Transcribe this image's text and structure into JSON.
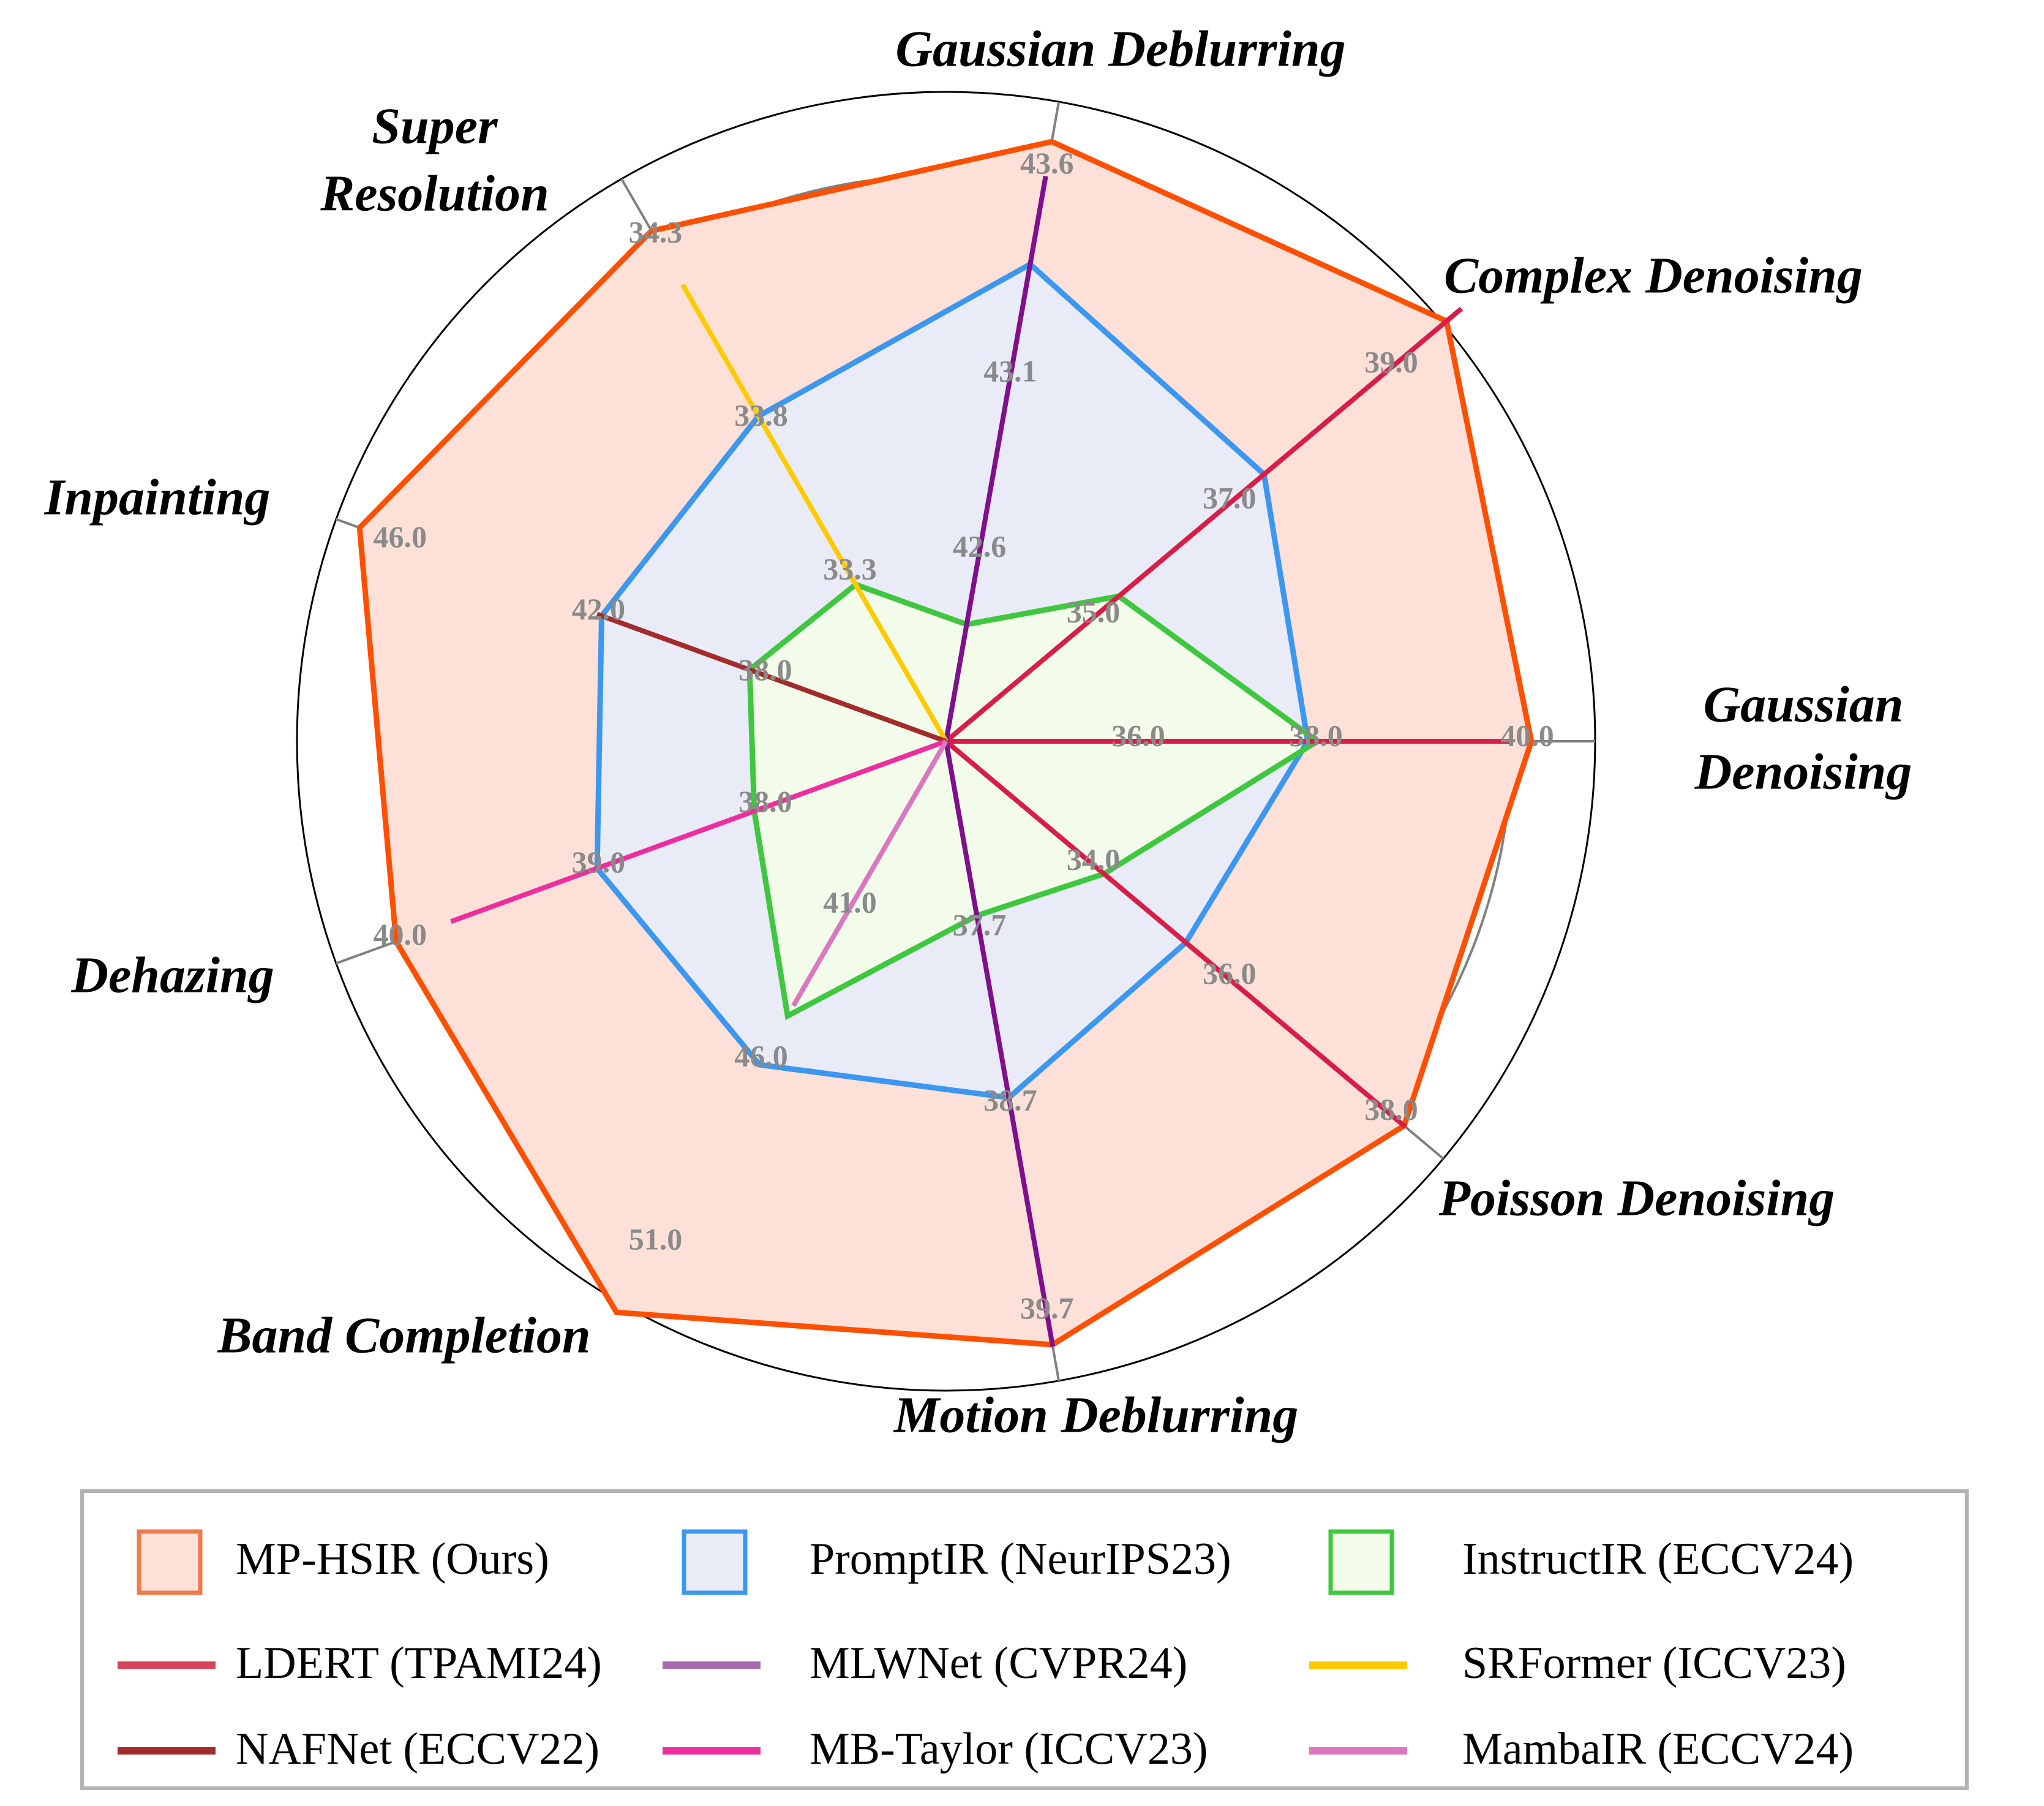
{
  "chart_data": {
    "type": "radar",
    "title": "",
    "axes": [
      {
        "label": "Gaussian Denoising",
        "ticks": [
          "36.0",
          "38.0",
          "40.0"
        ],
        "range": [
          34,
          40.4
        ]
      },
      {
        "label": "Complex Denoising",
        "ticks": [
          "35.0",
          "37.0",
          "39.0"
        ],
        "range": [
          33,
          40.3
        ]
      },
      {
        "label": "Gaussian Deblurring",
        "ticks": [
          "42.6",
          "43.1",
          "43.6"
        ],
        "range": [
          42.1,
          43.8
        ]
      },
      {
        "label": "Super Resolution",
        "ticks": [
          "33.3",
          "33.8",
          "34.3"
        ],
        "range": [
          32.8,
          34.5
        ]
      },
      {
        "label": "Inpainting",
        "ticks": [
          "38.0",
          "42.0",
          "46.0"
        ],
        "range": [
          34,
          47.5
        ]
      },
      {
        "label": "Dehazing",
        "ticks": [
          "38.0",
          "39.0",
          "40.0"
        ],
        "range": [
          37,
          40.2
        ]
      },
      {
        "label": "Band Completion",
        "ticks": [
          "41.0",
          "46.0",
          "51.0"
        ],
        "range": [
          36,
          53.5
        ]
      },
      {
        "label": "Motion Deblurring",
        "ticks": [
          "37.7",
          "38.7",
          "39.7"
        ],
        "range": [
          36.7,
          40.2
        ]
      },
      {
        "label": "Poisson Denoising",
        "ticks": [
          "34.0",
          "36.0",
          "38.0"
        ],
        "range": [
          32,
          38.5
        ]
      }
    ],
    "center_label": "20",
    "series": [
      {
        "name": "MP-HSIR (Ours)",
        "kind": "area",
        "color": "#ff4f00",
        "fill": "#fde1d8",
        "values": [
          40.2,
          39.9,
          43.71,
          34.36,
          47.2,
          40.1,
          53.4,
          39.94,
          38.33
        ]
      },
      {
        "name": "PromptIR (NeurIPS23)",
        "kind": "area",
        "color": "#3c97f0",
        "fill": "#e9ebf7",
        "values": [
          37.9,
          37.45,
          43.39,
          33.81,
          41.9,
          39.0,
          46.05,
          38.65,
          35.4
        ]
      },
      {
        "name": "InstructIR (ECCV24)",
        "kind": "area",
        "color": "#3fc73f",
        "fill": "#f3fcea",
        "values": [
          38.0,
          35.5,
          42.45,
          33.31,
          38.66,
          38.14,
          44.6,
          37.7,
          34.3
        ]
      },
      {
        "name": "LDERT (TPAMI24)",
        "kind": "line",
        "color": "#d81e48",
        "values": [
          40.0,
          40.1,
          null,
          null,
          null,
          null,
          null,
          null,
          38.35
        ]
      },
      {
        "name": "MLWNet (CVPR24)",
        "kind": "line",
        "color": "#7f0f8c",
        "values": [
          null,
          null,
          43.62,
          null,
          null,
          null,
          null,
          39.95,
          null
        ]
      },
      {
        "name": "SRFormer (ICCV23)",
        "kind": "line",
        "color": "#ffcb00",
        "values": [
          null,
          null,
          null,
          34.2,
          null,
          null,
          null,
          null,
          null
        ]
      },
      {
        "name": "NAFNet (ECCV22)",
        "kind": "line",
        "color": "#a42b2b",
        "values": [
          null,
          null,
          null,
          null,
          42.0,
          null,
          null,
          null,
          null
        ]
      },
      {
        "name": "MB-Taylor (ICCV23)",
        "kind": "line",
        "color": "#ee2e9f",
        "values": [
          null,
          null,
          null,
          null,
          null,
          39.8,
          null,
          null,
          null
        ]
      },
      {
        "name": "MambaIR (ECCV24)",
        "kind": "line",
        "color": "#db77bf",
        "values": [
          null,
          null,
          null,
          null,
          null,
          null,
          44.3,
          null,
          null
        ]
      }
    ],
    "legend_placement": "bottom",
    "grid": true
  },
  "legend": {
    "items": [
      {
        "label": "MP-HSIR (Ours)",
        "kind": "area",
        "color": "#f07a4e",
        "fill": "#fde1d8"
      },
      {
        "label": "PromptIR (NeurIPS23)",
        "kind": "area",
        "color": "#3c97f0",
        "fill": "#e9ebf7"
      },
      {
        "label": "InstructIR (ECCV24)",
        "kind": "area",
        "color": "#3fc73f",
        "fill": "#f3fcea"
      },
      {
        "label": "LDERT (TPAMI24)",
        "kind": "line",
        "color": "#d8435b"
      },
      {
        "label": "MLWNet (CVPR24)",
        "kind": "line",
        "color": "#a86aae"
      },
      {
        "label": "SRFormer (ICCV23)",
        "kind": "line",
        "color": "#ffcb00"
      },
      {
        "label": "NAFNet (ECCV22)",
        "kind": "line",
        "color": "#a42b2b"
      },
      {
        "label": "MB-Taylor (ICCV23)",
        "kind": "line",
        "color": "#ee2e9f"
      },
      {
        "label": "MambaIR (ECCV24)",
        "kind": "line",
        "color": "#db77bf"
      }
    ]
  }
}
